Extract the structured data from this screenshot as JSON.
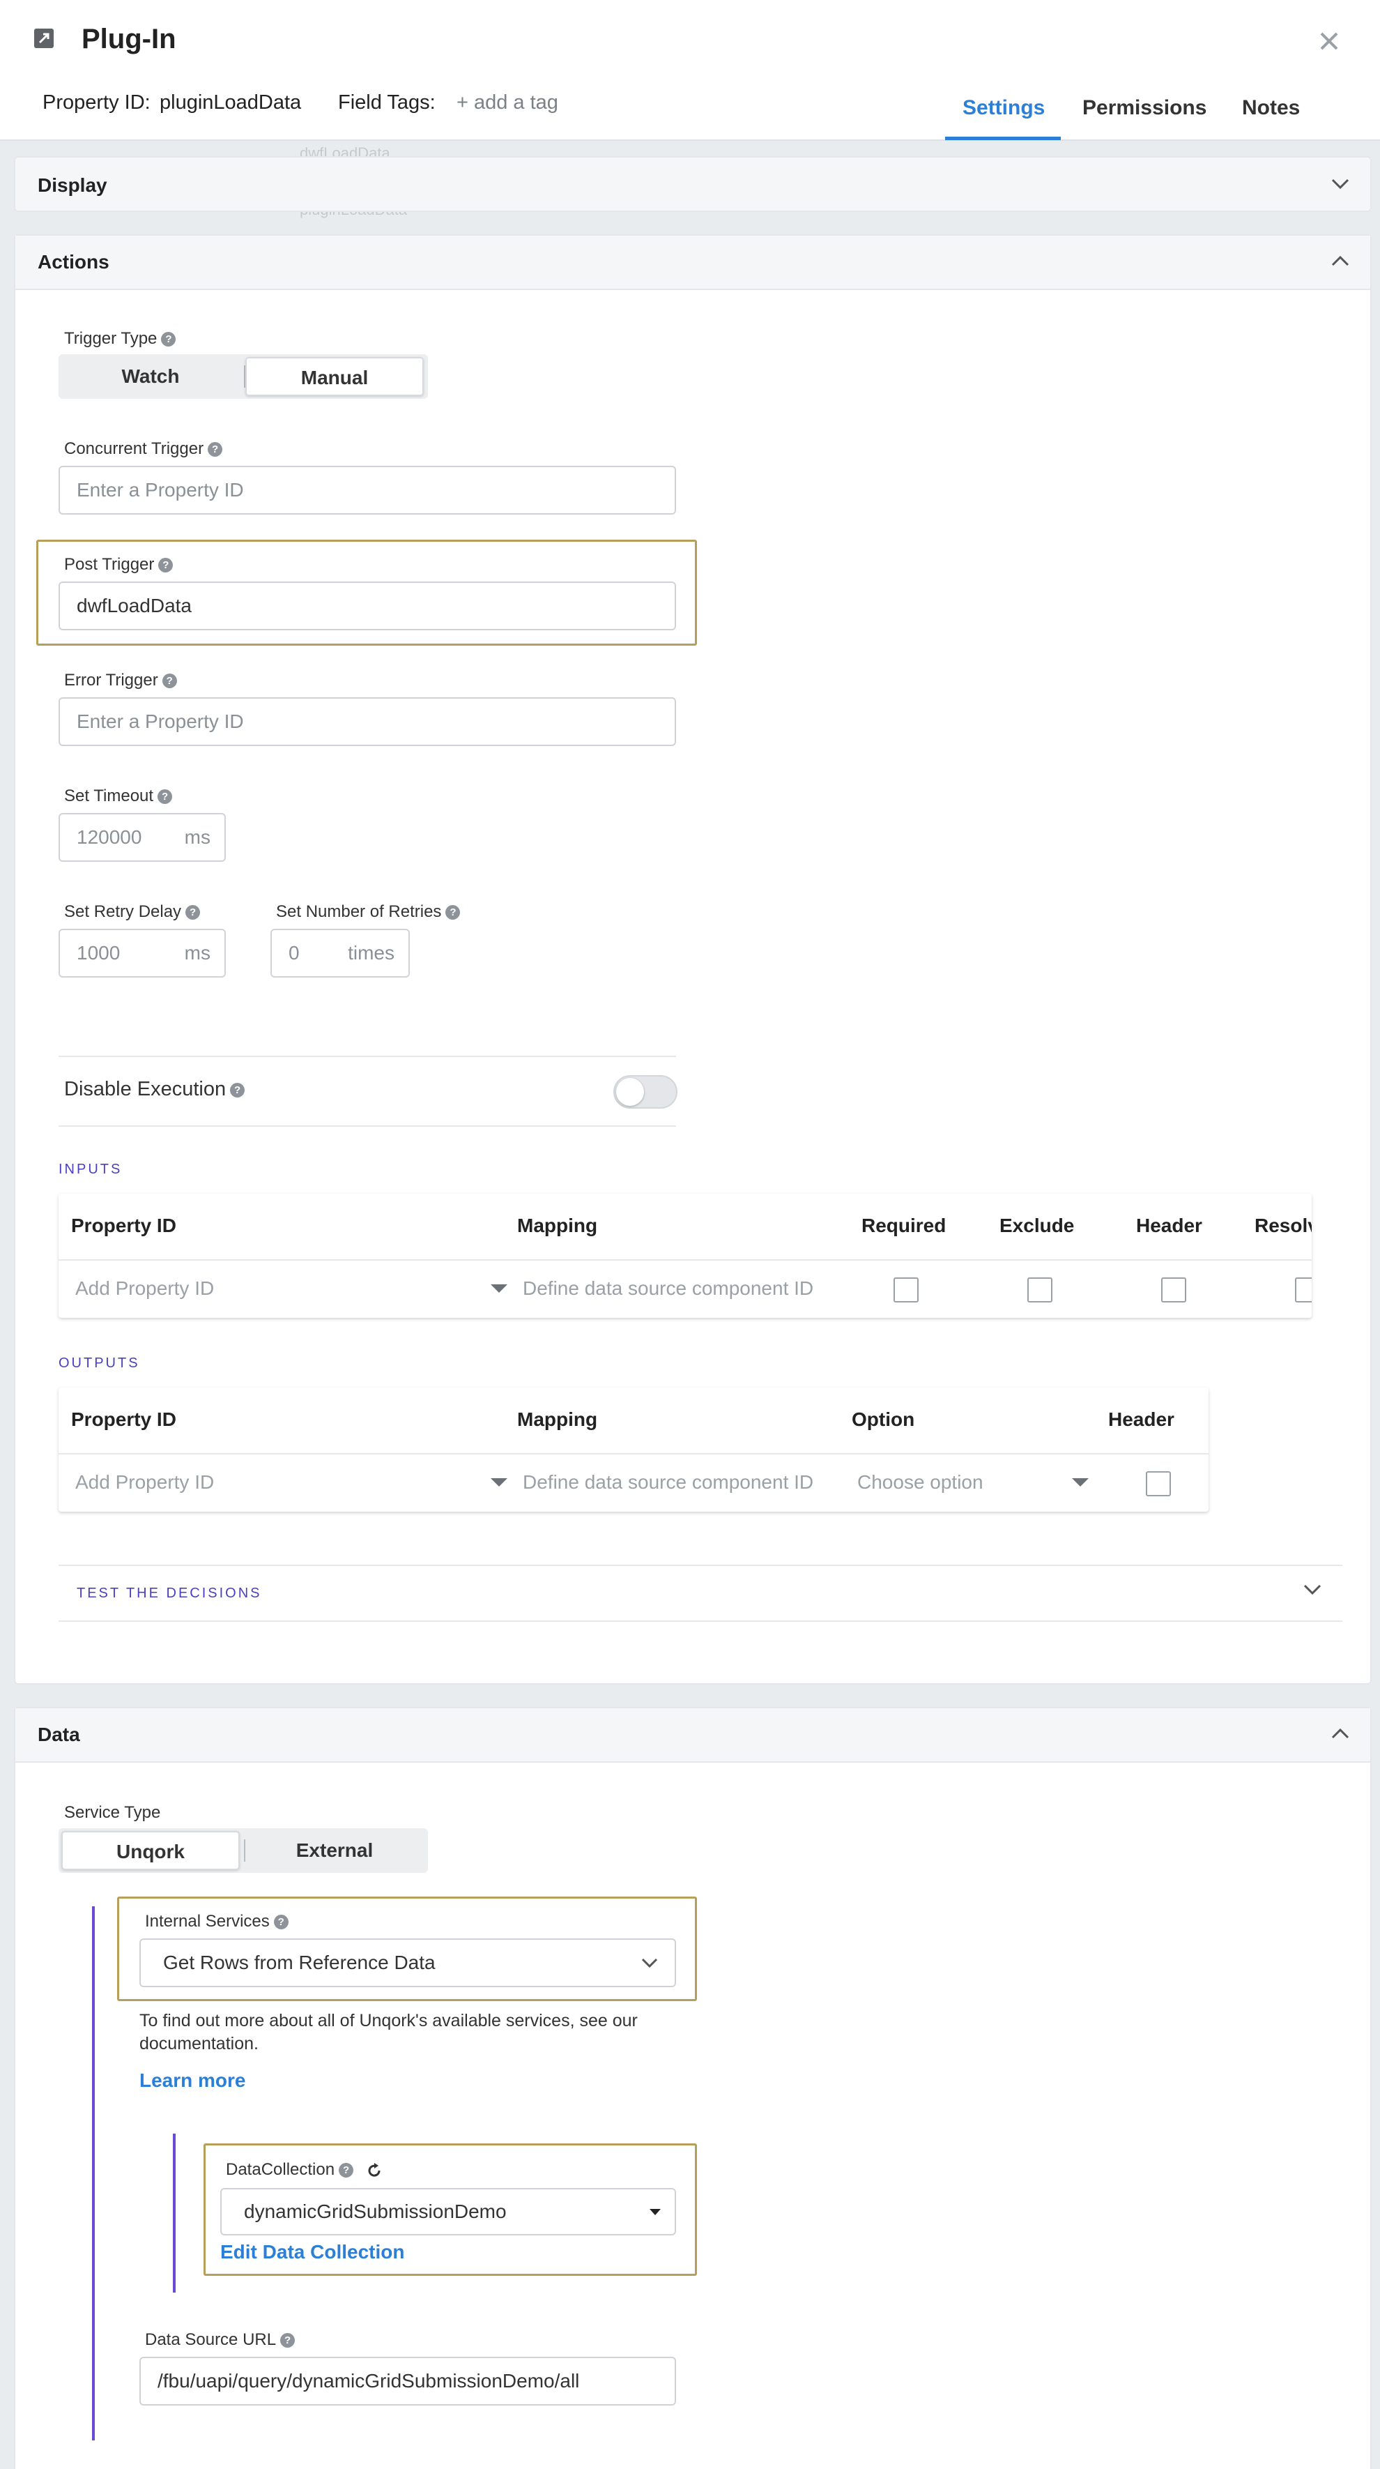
{
  "header": {
    "title": "Plug-In",
    "property_id_label": "Property ID:",
    "property_id_value": "pluginLoadData",
    "field_tags_label": "Field Tags:",
    "add_tag": "+ add a tag",
    "tabs": [
      {
        "label": "Settings",
        "active": true
      },
      {
        "label": "Permissions",
        "active": false
      },
      {
        "label": "Notes",
        "active": false
      }
    ],
    "accent_color": "#2b7fd6"
  },
  "background": {
    "ghost_texts": [
      "dwfLoadData",
      "pluginLoadData"
    ]
  },
  "display": {
    "title": "Display"
  },
  "actions": {
    "title": "Actions",
    "trigger_type": {
      "label": "Trigger Type",
      "options": [
        "Watch",
        "Manual"
      ],
      "selected": "Manual"
    },
    "concurrent_trigger": {
      "label": "Concurrent Trigger",
      "placeholder": "Enter a Property ID"
    },
    "post_trigger": {
      "label": "Post Trigger",
      "value": "dwfLoadData"
    },
    "error_trigger": {
      "label": "Error Trigger",
      "placeholder": "Enter a Property ID"
    },
    "set_timeout": {
      "label": "Set Timeout",
      "placeholder": "120000",
      "unit": "ms"
    },
    "retry_delay": {
      "label": "Set Retry Delay",
      "placeholder": "1000",
      "unit": "ms"
    },
    "retries": {
      "label": "Set Number of Retries",
      "placeholder": "0",
      "unit": "times"
    },
    "disable_execution": {
      "label": "Disable Execution",
      "enabled": false
    },
    "inputs": {
      "caption": "INPUTS",
      "columns": [
        "Property ID",
        "Mapping",
        "Required",
        "Exclude",
        "Header",
        "Resolve"
      ],
      "row": {
        "property_placeholder": "Add Property ID",
        "mapping_placeholder": "Define data source component ID"
      }
    },
    "outputs": {
      "caption": "OUTPUTS",
      "columns": [
        "Property ID",
        "Mapping",
        "Option",
        "Header"
      ],
      "row": {
        "property_placeholder": "Add Property ID",
        "mapping_placeholder": "Define data source component ID",
        "option_placeholder": "Choose option"
      }
    },
    "test_decisions": "TEST THE DECISIONS"
  },
  "data": {
    "title": "Data",
    "service_type": {
      "label": "Service Type",
      "options": [
        "Unqork",
        "External"
      ],
      "selected": "Unqork"
    },
    "internal_services": {
      "label": "Internal Services",
      "value": "Get Rows from Reference Data"
    },
    "help_text": [
      "To find out more about all of Unqork's available services, see our",
      "documentation."
    ],
    "learn_more": "Learn more",
    "data_collection": {
      "label": "DataCollection",
      "value": "dynamicGridSubmissionDemo",
      "edit_link": "Edit Data Collection"
    },
    "data_source_url": {
      "label": "Data Source URL",
      "value": "/fbu/uapi/query/dynamicGridSubmissionDemo/all"
    }
  }
}
